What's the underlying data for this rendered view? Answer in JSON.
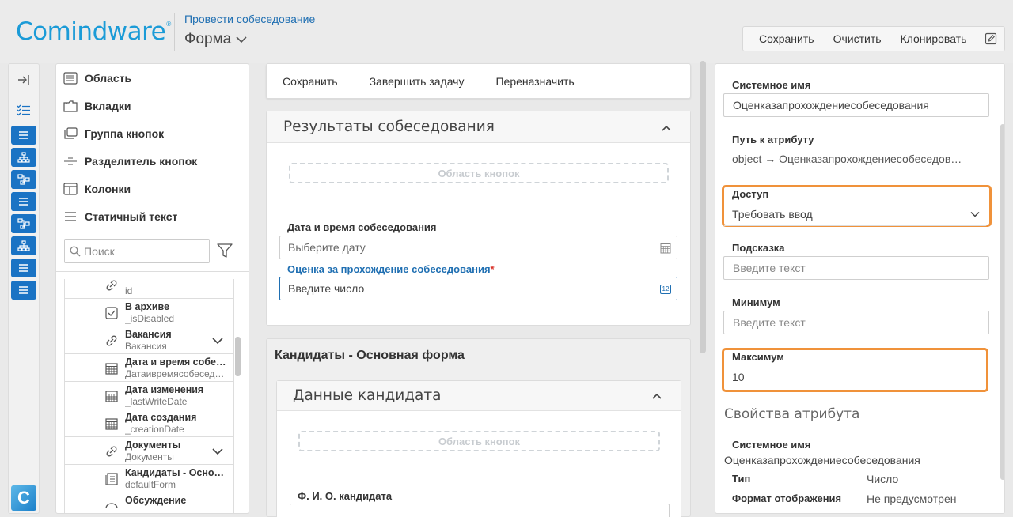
{
  "header": {
    "logo": "Comindware",
    "logo_mark": "®",
    "breadcrumb": "Провести собеседование",
    "form_title": "Форма",
    "toolbar": {
      "save": "Сохранить",
      "clear": "Очистить",
      "clone": "Клонировать"
    }
  },
  "palette": {
    "items": [
      {
        "label": "Область",
        "icon": "area-icon"
      },
      {
        "label": "Вкладки",
        "icon": "tabs-icon"
      },
      {
        "label": "Группа кнопок",
        "icon": "button-group-icon"
      },
      {
        "label": "Разделитель кнопок",
        "icon": "button-separator-icon"
      },
      {
        "label": "Колонки",
        "icon": "columns-icon"
      },
      {
        "label": "Статичный текст",
        "icon": "static-text-icon"
      }
    ],
    "search_placeholder": "Поиск",
    "attributes": [
      {
        "name": "",
        "sys": "id",
        "icon": "link-icon",
        "expandable": false
      },
      {
        "name": "В архиве",
        "sys": "_isDisabled",
        "icon": "checkbox-icon",
        "expandable": false
      },
      {
        "name": "Вакансия",
        "sys": "Вакансия",
        "icon": "link-icon",
        "expandable": true
      },
      {
        "name": "Дата и время собе…",
        "sys": "Датаивремясобесед…",
        "icon": "calendar-icon",
        "expandable": false
      },
      {
        "name": "Дата изменения",
        "sys": "_lastWriteDate",
        "icon": "calendar-icon",
        "expandable": false
      },
      {
        "name": "Дата создания",
        "sys": "_creationDate",
        "icon": "calendar-icon",
        "expandable": false
      },
      {
        "name": "Документы",
        "sys": "Документы",
        "icon": "link-icon",
        "expandable": true
      },
      {
        "name": "Кандидаты - Осно…",
        "sys": "defaultForm",
        "icon": "form-icon",
        "expandable": false
      },
      {
        "name": "Обсуждение",
        "sys": "",
        "icon": "discussion-icon",
        "expandable": false
      }
    ]
  },
  "canvas": {
    "toolbar": {
      "save": "Сохранить",
      "complete": "Завершить задачу",
      "reassign": "Переназначить"
    },
    "section1": {
      "title": "Результаты собеседования",
      "button_area": "Область кнопок",
      "date_label": "Дата и время собеседования",
      "date_placeholder": "Выберите дату",
      "score_label": "Оценка за прохождение собеседования",
      "required_mark": "*",
      "score_placeholder": "Введите число",
      "number_badge": "12"
    },
    "section2": {
      "title": "Кандидаты - Основная форма",
      "inner_title": "Данные кандидата",
      "button_area": "Область кнопок",
      "fio_label": "Ф. И. О. кандидата"
    }
  },
  "properties": {
    "system_name_label": "Системное имя",
    "system_name_value": "Оценказапрохождениесобеседования",
    "path_label": "Путь к атрибуту",
    "path_value": "object → Оценказапрохождениесобеседов…",
    "access_label": "Доступ",
    "access_value": "Требовать ввод",
    "hint_label": "Подсказка",
    "hint_placeholder": "Введите текст",
    "min_label": "Минимум",
    "min_placeholder": "Введите текст",
    "max_label": "Максимум",
    "max_value": "10",
    "attr_props_heading": "Свойства атрибута",
    "attr_sys_label": "Системное имя",
    "attr_sys_value": "Оценказапрохождениесобеседования",
    "type_label": "Тип",
    "type_value": "Число",
    "format_label": "Формат отображения",
    "format_value": "Не предусмотрен"
  },
  "colors": {
    "brand": "#1b9bd7",
    "rail_button": "#1a73c4",
    "highlight": "#f0923a",
    "link": "#1f6fb2"
  }
}
